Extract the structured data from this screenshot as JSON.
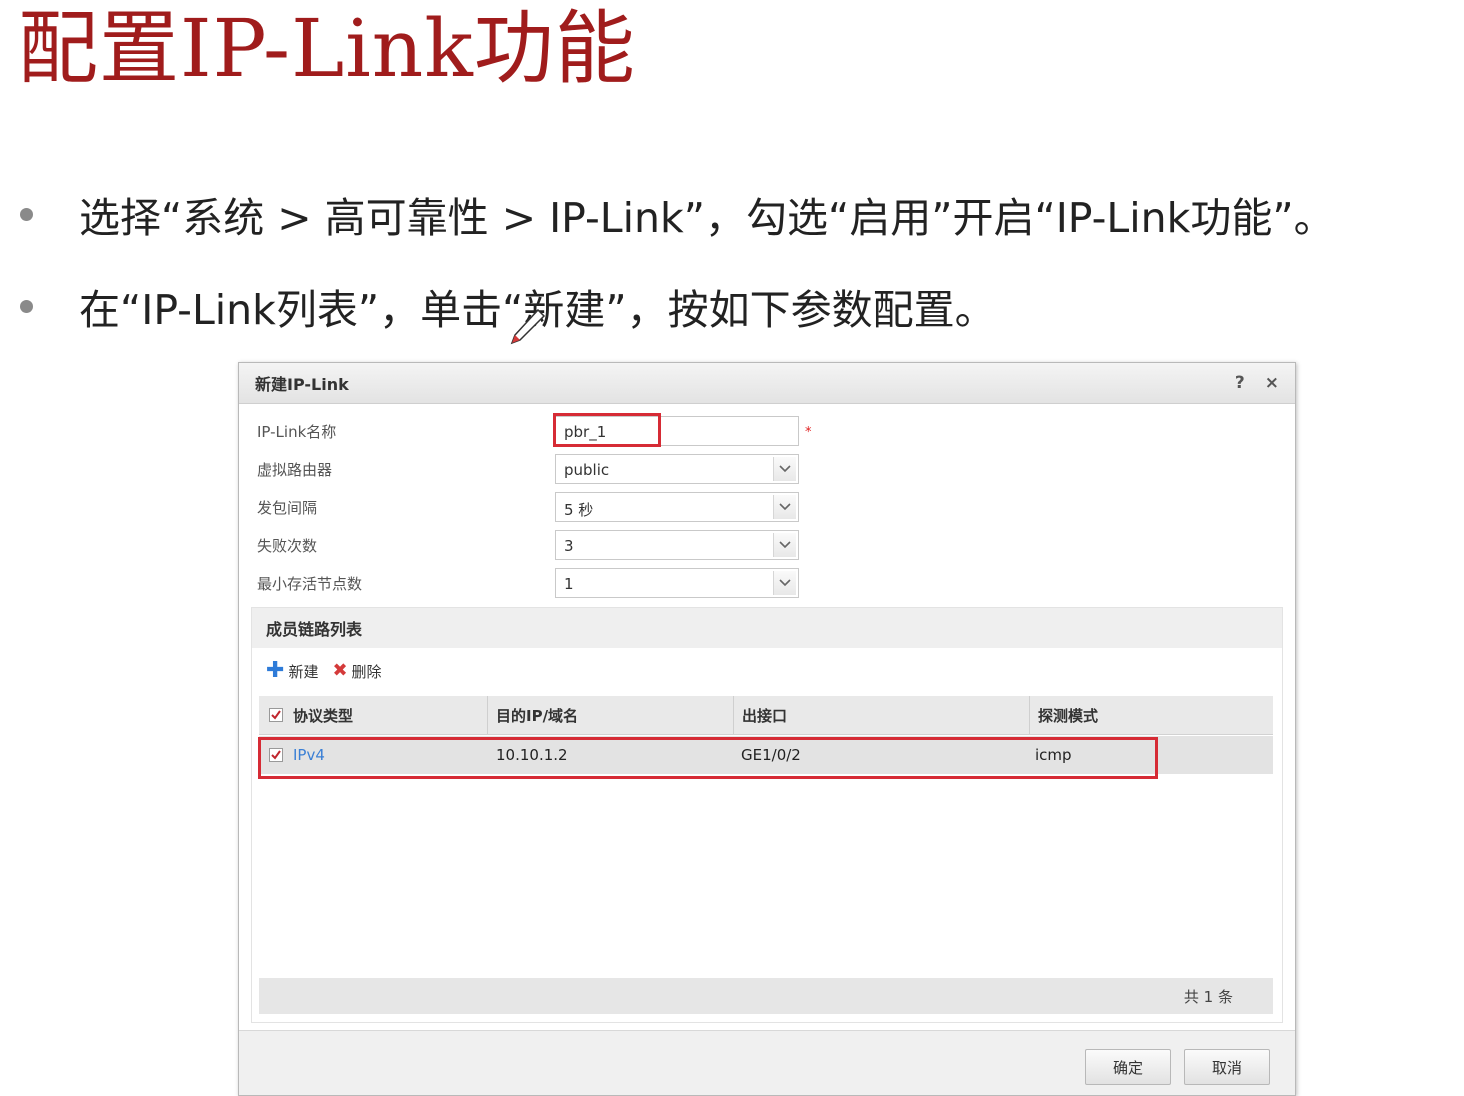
{
  "slide": {
    "title": "配置IP-Link功能",
    "bullets": [
      "选择“系统 > 高可靠性 > IP-Link”，勾选“启用”开启“IP-Link功能”。",
      "在“IP-Link列表”，单击“新建”，按如下参数配置。"
    ]
  },
  "dialog": {
    "title": "新建IP-Link",
    "help": "?",
    "close": "×",
    "fields": [
      {
        "label": "IP-Link名称",
        "value": "pbr_1",
        "required": true,
        "type": "text"
      },
      {
        "label": "虚拟路由器",
        "value": "public",
        "type": "select"
      },
      {
        "label": "发包间隔",
        "value": "5 秒",
        "type": "select"
      },
      {
        "label": "失败次数",
        "value": "3",
        "type": "select"
      },
      {
        "label": "最小存活节点数",
        "value": "1",
        "type": "select"
      }
    ],
    "required_mark": "*",
    "members": {
      "title": "成员链路列表",
      "toolbar": {
        "add": "新建",
        "delete": "删除"
      },
      "columns": [
        "协议类型",
        "目的IP/域名",
        "出接口",
        "探测模式"
      ],
      "rows": [
        {
          "protocol": "IPv4",
          "dest": "10.10.1.2",
          "interface": "GE1/0/2",
          "mode": "icmp",
          "checked": true
        }
      ],
      "total": "共 1 条"
    },
    "buttons": {
      "ok": "确定",
      "cancel": "取消"
    }
  },
  "colors": {
    "title_red": "#a01c1c",
    "highlight": "#d62b35",
    "link": "#3a7fd5"
  }
}
